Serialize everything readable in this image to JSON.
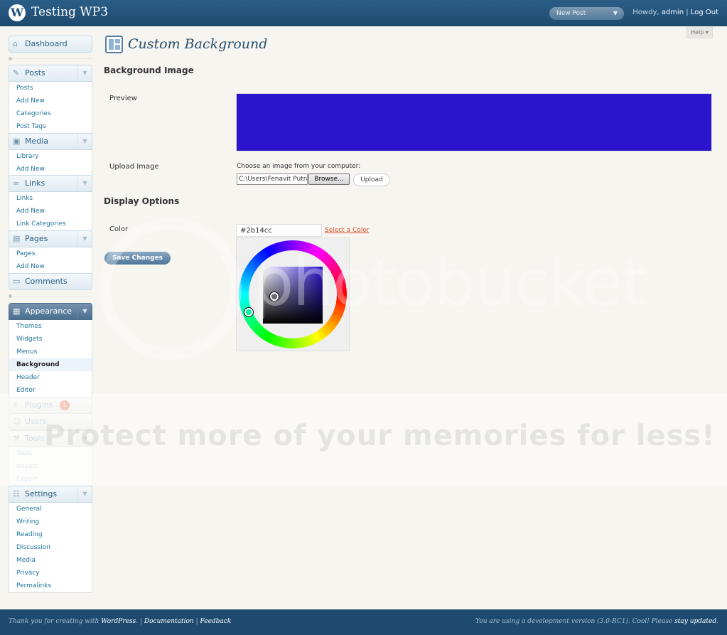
{
  "header": {
    "logo_glyph": "W",
    "site_title": "Testing WP3",
    "favorite_actions": "New Post",
    "howdy": "Howdy,",
    "user": "admin",
    "separator": "|",
    "logout": "Log Out",
    "help": "Help ▾"
  },
  "sidebar": {
    "dashboard": "Dashboard",
    "posts": {
      "label": "Posts",
      "items": [
        "Posts",
        "Add New",
        "Categories",
        "Post Tags"
      ]
    },
    "media": {
      "label": "Media",
      "items": [
        "Library",
        "Add New"
      ]
    },
    "links": {
      "label": "Links",
      "items": [
        "Links",
        "Add New",
        "Link Categories"
      ]
    },
    "pages": {
      "label": "Pages",
      "items": [
        "Pages",
        "Add New"
      ]
    },
    "comments": "Comments",
    "appearance": {
      "label": "Appearance",
      "items": [
        "Themes",
        "Widgets",
        "Menus",
        "Background",
        "Header",
        "Editor"
      ]
    },
    "plugins": {
      "label": "Plugins",
      "badge": "1"
    },
    "users": "Users",
    "tools": {
      "label": "Tools",
      "items": [
        "Tools",
        "Import",
        "Export"
      ]
    },
    "settings": {
      "label": "Settings",
      "items": [
        "General",
        "Writing",
        "Reading",
        "Discussion",
        "Media",
        "Privacy",
        "Permalinks"
      ]
    }
  },
  "main": {
    "page_title": "Custom Background",
    "background_image_heading": "Background Image",
    "preview_label": "Preview",
    "preview_color": "#2b14cc",
    "upload_image_label": "Upload Image",
    "upload_help": "Choose an image from your computer:",
    "file_value": "C:\\Users\\Fenavit Putra",
    "browse_label": "Browse...",
    "upload_label": "Upload",
    "display_options_heading": "Display Options",
    "color_label": "Color",
    "color_value": "#2b14cc",
    "select_color_link": "Select a Color",
    "save_label": "Save Changes"
  },
  "watermark": {
    "logo_word": "photobucket",
    "band_text": "Protect more of your memories for less!"
  },
  "footer": {
    "thank_you": "Thank you for creating with",
    "wordpress": "WordPress",
    "dot": ".",
    "sep1": "|",
    "documentation": "Documentation",
    "sep2": "|",
    "feedback": "Feedback",
    "version_note": "You are using a development version (3.0-RC1). Cool! Please",
    "stay_updated": "stay updated",
    "end_dot": "."
  },
  "colors": {
    "header_bg": "#1e4a70",
    "accent_link": "#21759b",
    "highlight_link": "#d54e21",
    "selected_bg_color": "#2b14cc"
  }
}
